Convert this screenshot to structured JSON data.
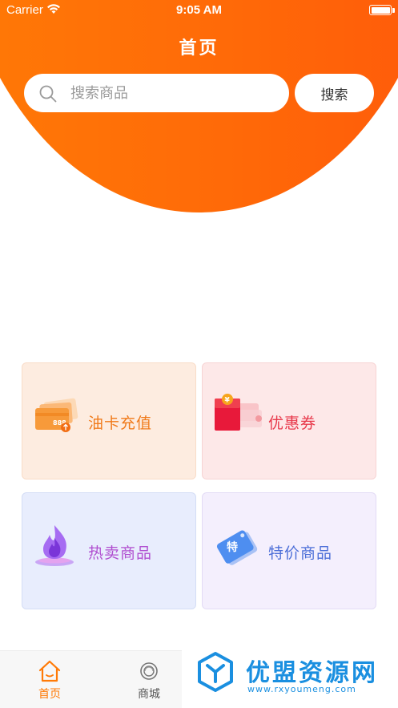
{
  "status_bar": {
    "carrier": "Carrier",
    "time": "9:05 AM"
  },
  "header": {
    "title": "首页",
    "gradient_start": "#ff7a06",
    "gradient_end": "#ff5a0a"
  },
  "search": {
    "placeholder": "搜索商品",
    "value": "",
    "button_label": "搜索"
  },
  "cards": [
    {
      "label": "油卡充值",
      "icon": "fuel-card-icon",
      "color": "#f07a1a",
      "background": "#fdece0",
      "icon_text": "888"
    },
    {
      "label": "优惠券",
      "icon": "coupon-icon",
      "color": "#e8384a",
      "background": "#fde8e8",
      "icon_text": "¥"
    },
    {
      "label": "热卖商品",
      "icon": "flame-icon",
      "color": "#b04fd0",
      "background": "#e8edfd"
    },
    {
      "label": "特价商品",
      "icon": "price-tag-icon",
      "color": "#4d6fd8",
      "background": "#f4effd",
      "icon_text": "特"
    }
  ],
  "tab_bar": {
    "items": [
      {
        "label": "首页",
        "icon": "home-icon",
        "active": true
      },
      {
        "label": "商城",
        "icon": "mall-icon",
        "active": false
      }
    ],
    "active_color": "#ff7a06"
  },
  "watermark": {
    "title": "优盟资源网",
    "url": "www.rxyoumeng.com",
    "color": "#1a8fe0"
  }
}
